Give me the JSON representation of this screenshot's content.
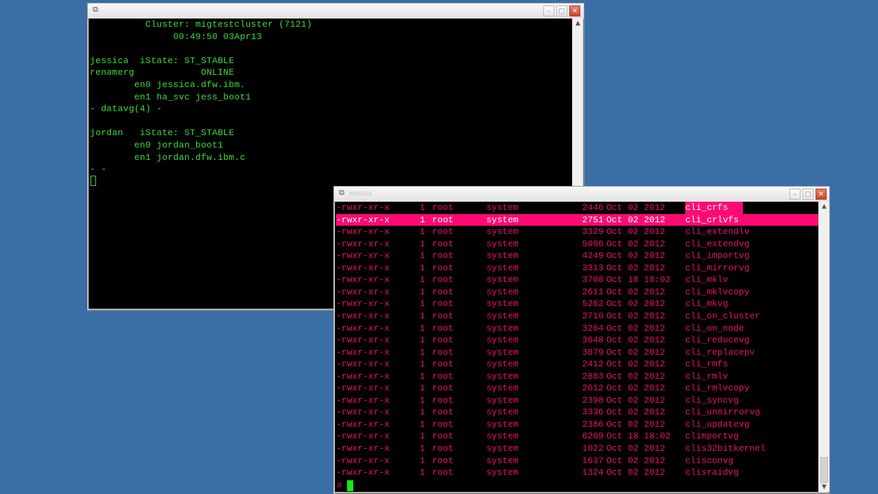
{
  "left_window": {
    "title_icon": "putty-icon",
    "controls": {
      "minimize": "–",
      "maximize": "□",
      "close": "✕"
    },
    "lines": [
      "          Cluster: migtestcluster (7121)",
      "               00:49:50 03Apr13",
      "",
      "jessica  iState: ST_STABLE",
      "renamerg            ONLINE",
      "        en0 jessica.dfw.ibm.",
      "        en1 ha_svc jess_boot1",
      "- datavg(4) -",
      "",
      "jordan   iState: ST_STABLE",
      "        en0 jordan_boot1",
      "        en1 jordan.dfw.ibm.c",
      "- -"
    ]
  },
  "right_window": {
    "title": "jessica",
    "title_icon": "putty-icon",
    "controls": {
      "minimize": "–",
      "maximize": "□",
      "close": "✕"
    },
    "prompt": "#",
    "rows": [
      {
        "perm": "-rwxr-xr-x",
        "links": "1",
        "owner": "root",
        "group": "system",
        "size": "2446",
        "date": "Oct 02 2012",
        "name": "cli_crfs",
        "highlight": "name"
      },
      {
        "perm": "-rwxr-xr-x",
        "links": "1",
        "owner": "root",
        "group": "system",
        "size": "2751",
        "date": "Oct 02 2012",
        "name": "cli_crlvfs",
        "highlight": "row"
      },
      {
        "perm": "-rwxr-xr-x",
        "links": "1",
        "owner": "root",
        "group": "system",
        "size": "3329",
        "date": "Oct 02 2012",
        "name": "cli_extendlv"
      },
      {
        "perm": "-rwxr-xr-x",
        "links": "1",
        "owner": "root",
        "group": "system",
        "size": "5096",
        "date": "Oct 02 2012",
        "name": "cli_extendvg"
      },
      {
        "perm": "-rwxr-xr-x",
        "links": "1",
        "owner": "root",
        "group": "system",
        "size": "4249",
        "date": "Oct 02 2012",
        "name": "cli_importvg"
      },
      {
        "perm": "-rwxr-xr-x",
        "links": "1",
        "owner": "root",
        "group": "system",
        "size": "3313",
        "date": "Oct 02 2012",
        "name": "cli_mirrorvg"
      },
      {
        "perm": "-rwxr-xr-x",
        "links": "1",
        "owner": "root",
        "group": "system",
        "size": "3708",
        "date": "Oct 18 18:02",
        "name": "cli_mklv"
      },
      {
        "perm": "-rwxr-xr-x",
        "links": "1",
        "owner": "root",
        "group": "system",
        "size": "2611",
        "date": "Oct 02 2012",
        "name": "cli_mklvcopy"
      },
      {
        "perm": "-rwxr-xr-x",
        "links": "1",
        "owner": "root",
        "group": "system",
        "size": "5262",
        "date": "Oct 02 2012",
        "name": "cli_mkvg"
      },
      {
        "perm": "-rwxr-xr-x",
        "links": "1",
        "owner": "root",
        "group": "system",
        "size": "2710",
        "date": "Oct 02 2012",
        "name": "cli_on_cluster"
      },
      {
        "perm": "-rwxr-xr-x",
        "links": "1",
        "owner": "root",
        "group": "system",
        "size": "3264",
        "date": "Oct 02 2012",
        "name": "cli_on_node"
      },
      {
        "perm": "-rwxr-xr-x",
        "links": "1",
        "owner": "root",
        "group": "system",
        "size": "3648",
        "date": "Oct 02 2012",
        "name": "cli_reducevg"
      },
      {
        "perm": "-rwxr-xr-x",
        "links": "1",
        "owner": "root",
        "group": "system",
        "size": "3879",
        "date": "Oct 02 2012",
        "name": "cli_replacepv"
      },
      {
        "perm": "-rwxr-xr-x",
        "links": "1",
        "owner": "root",
        "group": "system",
        "size": "2412",
        "date": "Oct 02 2012",
        "name": "cli_rmfs"
      },
      {
        "perm": "-rwxr-xr-x",
        "links": "1",
        "owner": "root",
        "group": "system",
        "size": "2883",
        "date": "Oct 02 2012",
        "name": "cli_rmlv"
      },
      {
        "perm": "-rwxr-xr-x",
        "links": "1",
        "owner": "root",
        "group": "system",
        "size": "2612",
        "date": "Oct 02 2012",
        "name": "cli_rmlvcopy"
      },
      {
        "perm": "-rwxr-xr-x",
        "links": "1",
        "owner": "root",
        "group": "system",
        "size": "2398",
        "date": "Oct 02 2012",
        "name": "cli_syncvg"
      },
      {
        "perm": "-rwxr-xr-x",
        "links": "1",
        "owner": "root",
        "group": "system",
        "size": "3336",
        "date": "Oct 02 2012",
        "name": "cli_unmirrorvg"
      },
      {
        "perm": "-rwxr-xr-x",
        "links": "1",
        "owner": "root",
        "group": "system",
        "size": "2386",
        "date": "Oct 02 2012",
        "name": "cli_updatevg"
      },
      {
        "perm": "-rwxr-xr-x",
        "links": "1",
        "owner": "root",
        "group": "system",
        "size": "6269",
        "date": "Oct 18 18:02",
        "name": "climportvg"
      },
      {
        "perm": "-rwxr-xr-x",
        "links": "1",
        "owner": "root",
        "group": "system",
        "size": "1022",
        "date": "Oct 02 2012",
        "name": "clis32bitkernel"
      },
      {
        "perm": "-rwxr-xr-x",
        "links": "1",
        "owner": "root",
        "group": "system",
        "size": "1637",
        "date": "Oct 02 2012",
        "name": "clisconvg"
      },
      {
        "perm": "-rwxr-xr-x",
        "links": "1",
        "owner": "root",
        "group": "system",
        "size": "1324",
        "date": "Oct 02 2012",
        "name": "clisraidvg"
      }
    ]
  },
  "colors": {
    "desktop": "#3a6ea5",
    "terminal_bg": "#000000",
    "green_text": "#3ddc3d",
    "magenta_text": "#e8106e",
    "highlight": "#ff0a73"
  }
}
